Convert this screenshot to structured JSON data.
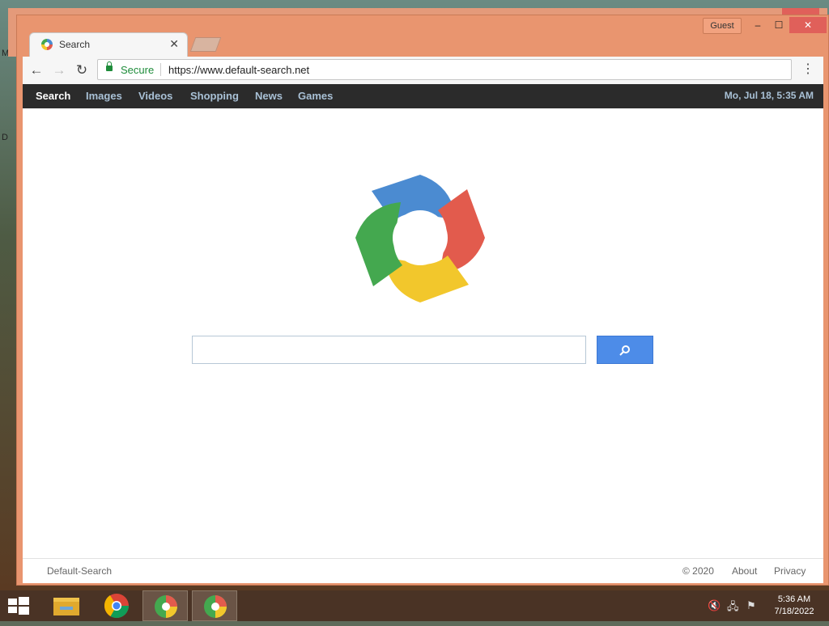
{
  "desktop": {
    "side_letters": [
      "M",
      "D"
    ]
  },
  "window": {
    "guest_label": "Guest",
    "minimize_icon": "–",
    "maximize_icon": "☐",
    "close_icon": "✕"
  },
  "tab": {
    "title": "Search",
    "close_icon": "✕",
    "favicon": "default-search-logo"
  },
  "toolbar": {
    "back_icon": "←",
    "forward_icon": "→",
    "reload_icon": "↻",
    "secure_label": "Secure",
    "url": "https://www.default-search.net",
    "menu_icon": "⋮"
  },
  "topnav": {
    "items": [
      "Search",
      "Images",
      "Videos",
      "Shopping",
      "News",
      "Games"
    ],
    "active": "Search",
    "datetime": "Mo, Jul 18, 5:35 AM"
  },
  "search": {
    "input_value": "",
    "button_icon": "search-icon"
  },
  "footer": {
    "brand": "Default-Search",
    "copyright": "© 2020",
    "about": "About",
    "privacy": "Privacy"
  },
  "taskbar": {
    "time": "5:36 AM",
    "date": "7/18/2022"
  },
  "colors": {
    "accent": "#4d8ce8",
    "frame": "#e9956f",
    "nav_bg": "#2b2b2b",
    "secure_green": "#1e8c3a"
  }
}
